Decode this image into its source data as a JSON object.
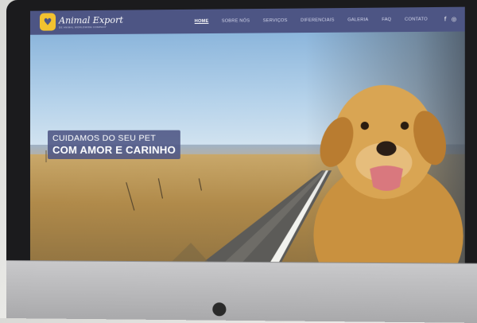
{
  "site": {
    "brand": "Animal Export",
    "brand_sub": "DE ANIMAL WORLDWIDE COMPANY",
    "logo_icon": "paw-heart-icon"
  },
  "nav": {
    "items": [
      {
        "label": "HOME",
        "active": true
      },
      {
        "label": "SOBRE NÓS",
        "active": false
      },
      {
        "label": "SERVIÇOS",
        "active": false
      },
      {
        "label": "DIFERENCIAIS",
        "active": false
      },
      {
        "label": "GALERIA",
        "active": false
      },
      {
        "label": "FAQ",
        "active": false
      },
      {
        "label": "CONTATO",
        "active": false
      }
    ],
    "social": [
      "facebook-icon",
      "instagram-icon"
    ]
  },
  "hero": {
    "line1": "CUIDAMOS DO SEU PET",
    "line2": "COM AMOR E CARINHO",
    "slides": 3,
    "active_slide": 1
  },
  "colors": {
    "header": "#4d5584",
    "logo": "#f2c230"
  }
}
